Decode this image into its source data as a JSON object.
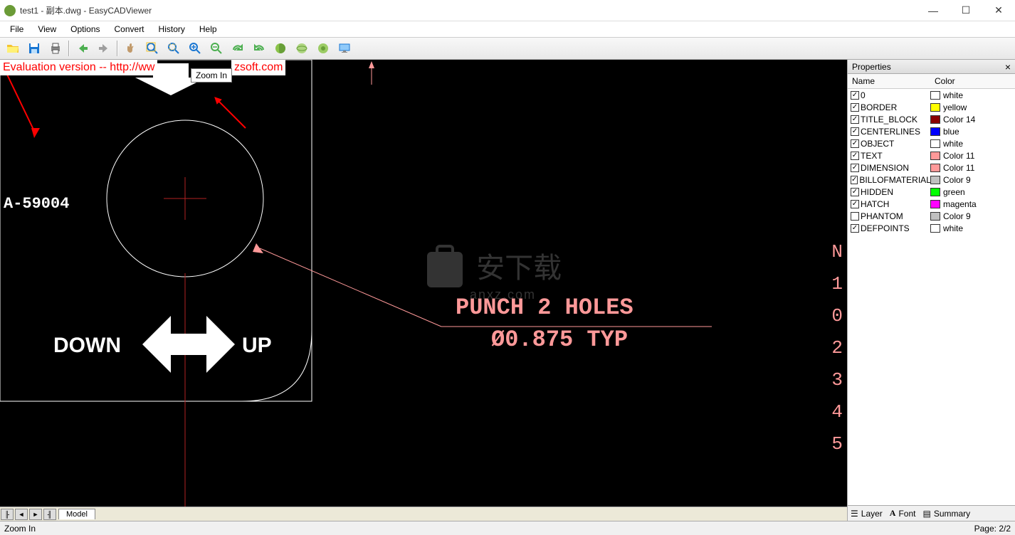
{
  "window": {
    "title": "test1 - 副本.dwg - EasyCADViewer"
  },
  "menu": [
    "File",
    "View",
    "Options",
    "Convert",
    "History",
    "Help"
  ],
  "tooltip": "Zoom In",
  "eval_text_left": "Evaluation version -- http://ww",
  "eval_text_right": "zsoft.com",
  "canvas": {
    "label_a": "A-59004",
    "down": "DOWN",
    "up": "UP",
    "punch1": "PUNCH 2 HOLES",
    "punch2": "Ø0.875 TYP",
    "side": [
      "N",
      "1",
      "0",
      "2",
      "3",
      "4",
      "5"
    ],
    "watermark": "安下载",
    "watermark_sub": "anxz.com"
  },
  "properties": {
    "title": "Properties",
    "col1": "Name",
    "col2": "Color",
    "layers": [
      {
        "name": "0",
        "on": true,
        "color": "#ffffff",
        "cname": "white"
      },
      {
        "name": "BORDER",
        "on": true,
        "color": "#ffff00",
        "cname": "yellow"
      },
      {
        "name": "TITLE_BLOCK",
        "on": true,
        "color": "#8b0000",
        "cname": "Color 14"
      },
      {
        "name": "CENTERLINES",
        "on": true,
        "color": "#0000ff",
        "cname": "blue"
      },
      {
        "name": "OBJECT",
        "on": true,
        "color": "#ffffff",
        "cname": "white"
      },
      {
        "name": "TEXT",
        "on": true,
        "color": "#ff9999",
        "cname": "Color 11"
      },
      {
        "name": "DIMENSION",
        "on": true,
        "color": "#ff9999",
        "cname": "Color 11"
      },
      {
        "name": "BILLOFMATERIAL",
        "on": true,
        "color": "#c0c0c0",
        "cname": "Color 9"
      },
      {
        "name": "HIDDEN",
        "on": true,
        "color": "#00ff00",
        "cname": "green"
      },
      {
        "name": "HATCH",
        "on": true,
        "color": "#ff00ff",
        "cname": "magenta"
      },
      {
        "name": "PHANTOM",
        "on": false,
        "color": "#c0c0c0",
        "cname": "Color 9"
      },
      {
        "name": "DEFPOINTS",
        "on": true,
        "color": "#ffffff",
        "cname": "white"
      }
    ],
    "tabs": [
      "Layer",
      "Font",
      "Summary"
    ]
  },
  "model_tab": "Model",
  "status": {
    "left": "Zoom In",
    "right": "Page: 2/2"
  }
}
